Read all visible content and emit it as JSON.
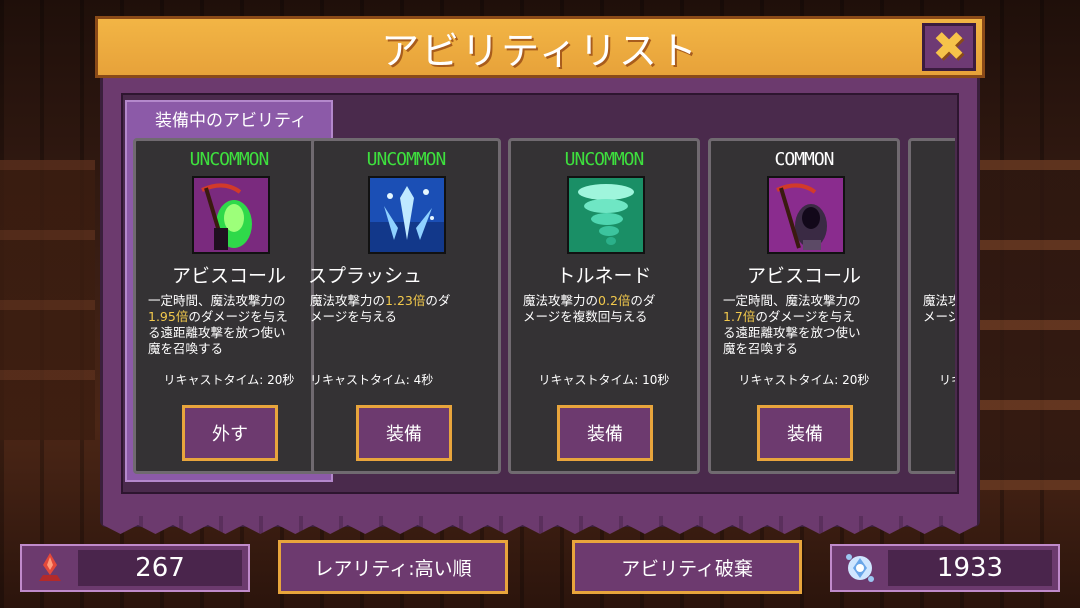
{
  "dialog": {
    "title": "アビリティリスト",
    "close_icon": "close-icon"
  },
  "equipped_section": {
    "label": "装備中のアビリティ"
  },
  "cards": [
    {
      "rarity": "UNCOMMON",
      "rarity_color": "#3ee03e",
      "name": "アビスコール",
      "desc_parts": [
        "一定時間、魔法攻撃力の\n",
        "1.95倍",
        "のダメージを与え\nる遠距離攻撃を放つ使い\n魔を召喚する"
      ],
      "recast": "リキャストタイム: 20秒",
      "button": "外す",
      "icon": "reaper-green-icon"
    },
    {
      "rarity": "UNCOMMON",
      "rarity_color": "#3ee03e",
      "name": "スプラッシュ",
      "desc_parts": [
        "魔法攻撃力の",
        "1.23倍",
        "のダ\nメージを与える"
      ],
      "recast": "リキャストタイム: 4秒",
      "button": "装備",
      "icon": "water-splash-icon"
    },
    {
      "rarity": "UNCOMMON",
      "rarity_color": "#3ee03e",
      "name": "トルネード",
      "desc_parts": [
        "魔法攻撃力の",
        "0.2倍",
        "のダ\nメージを複数回与える"
      ],
      "recast": "リキャストタイム: 10秒",
      "button": "装備",
      "icon": "tornado-icon"
    },
    {
      "rarity": "COMMON",
      "rarity_color": "#ffffff",
      "name": "アビスコール",
      "desc_parts": [
        "一定時間、魔法攻撃力の\n",
        "1.7倍",
        "のダメージを与え\nる遠距離攻撃を放つ使い\n魔を召喚する"
      ],
      "recast": "リキャストタイム: 20秒",
      "button": "装備",
      "icon": "reaper-purple-icon"
    },
    {
      "rarity": "",
      "rarity_color": "#ffffff",
      "name": "",
      "desc_parts": [
        "魔法攻\nメージ",
        "",
        ""
      ],
      "recast": "リキ",
      "button": "",
      "icon": ""
    }
  ],
  "bottom": {
    "left_resource_value": "267",
    "left_resource_icon": "red-crystal-icon",
    "sort_button": "レアリティ:高い順",
    "destroy_button": "アビリティ破棄",
    "right_resource_value": "1933",
    "right_resource_icon": "blue-gem-icon"
  }
}
